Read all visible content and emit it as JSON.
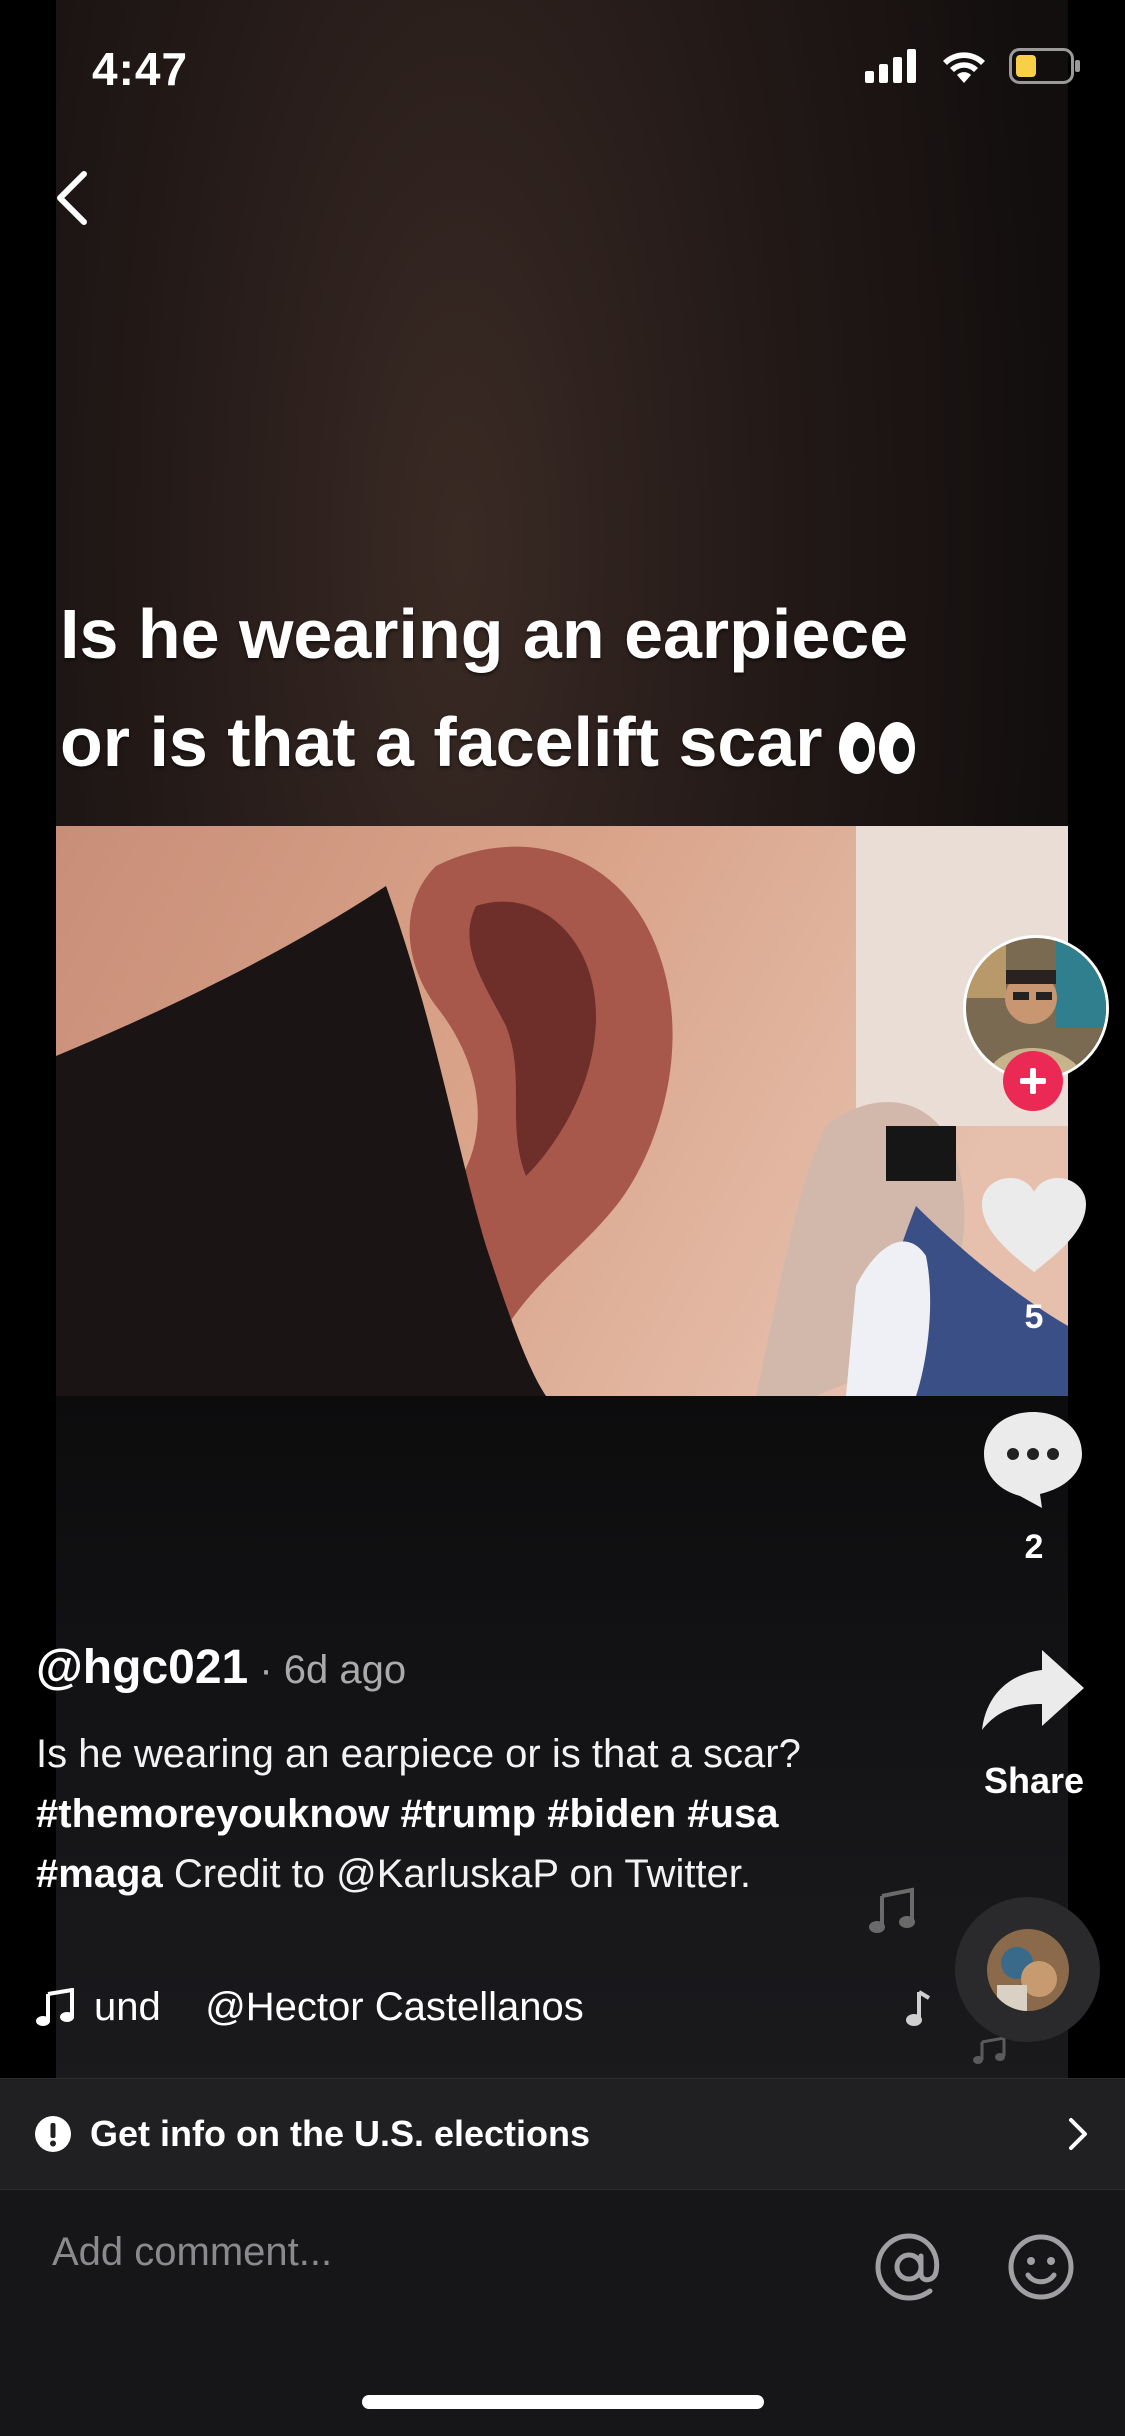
{
  "status_bar": {
    "time": "4:47"
  },
  "video": {
    "caption_line1": "Is he wearing an earpiece",
    "caption_line2": "or is that a facelift scar"
  },
  "actions": {
    "like_count": "5",
    "comment_count": "2",
    "share_label": "Share"
  },
  "post": {
    "handle": "@hgc021",
    "separator": " · ",
    "time_ago": "6d ago",
    "description_text": "Is he wearing an earpiece or is that a scar? ",
    "hashtags": [
      "#themoreyouknow",
      "#trump",
      "#biden",
      "#usa",
      "#maga"
    ],
    "credit_text": " Credit to @KarluskaP on Twitter."
  },
  "music": {
    "text": "und    @Hector Castellanos"
  },
  "elections_banner": {
    "label": "Get info on the U.S. elections"
  },
  "comment": {
    "placeholder": "Add comment..."
  },
  "colors": {
    "follow_red": "#ea2a55",
    "battery_yellow": "#f7d047"
  }
}
